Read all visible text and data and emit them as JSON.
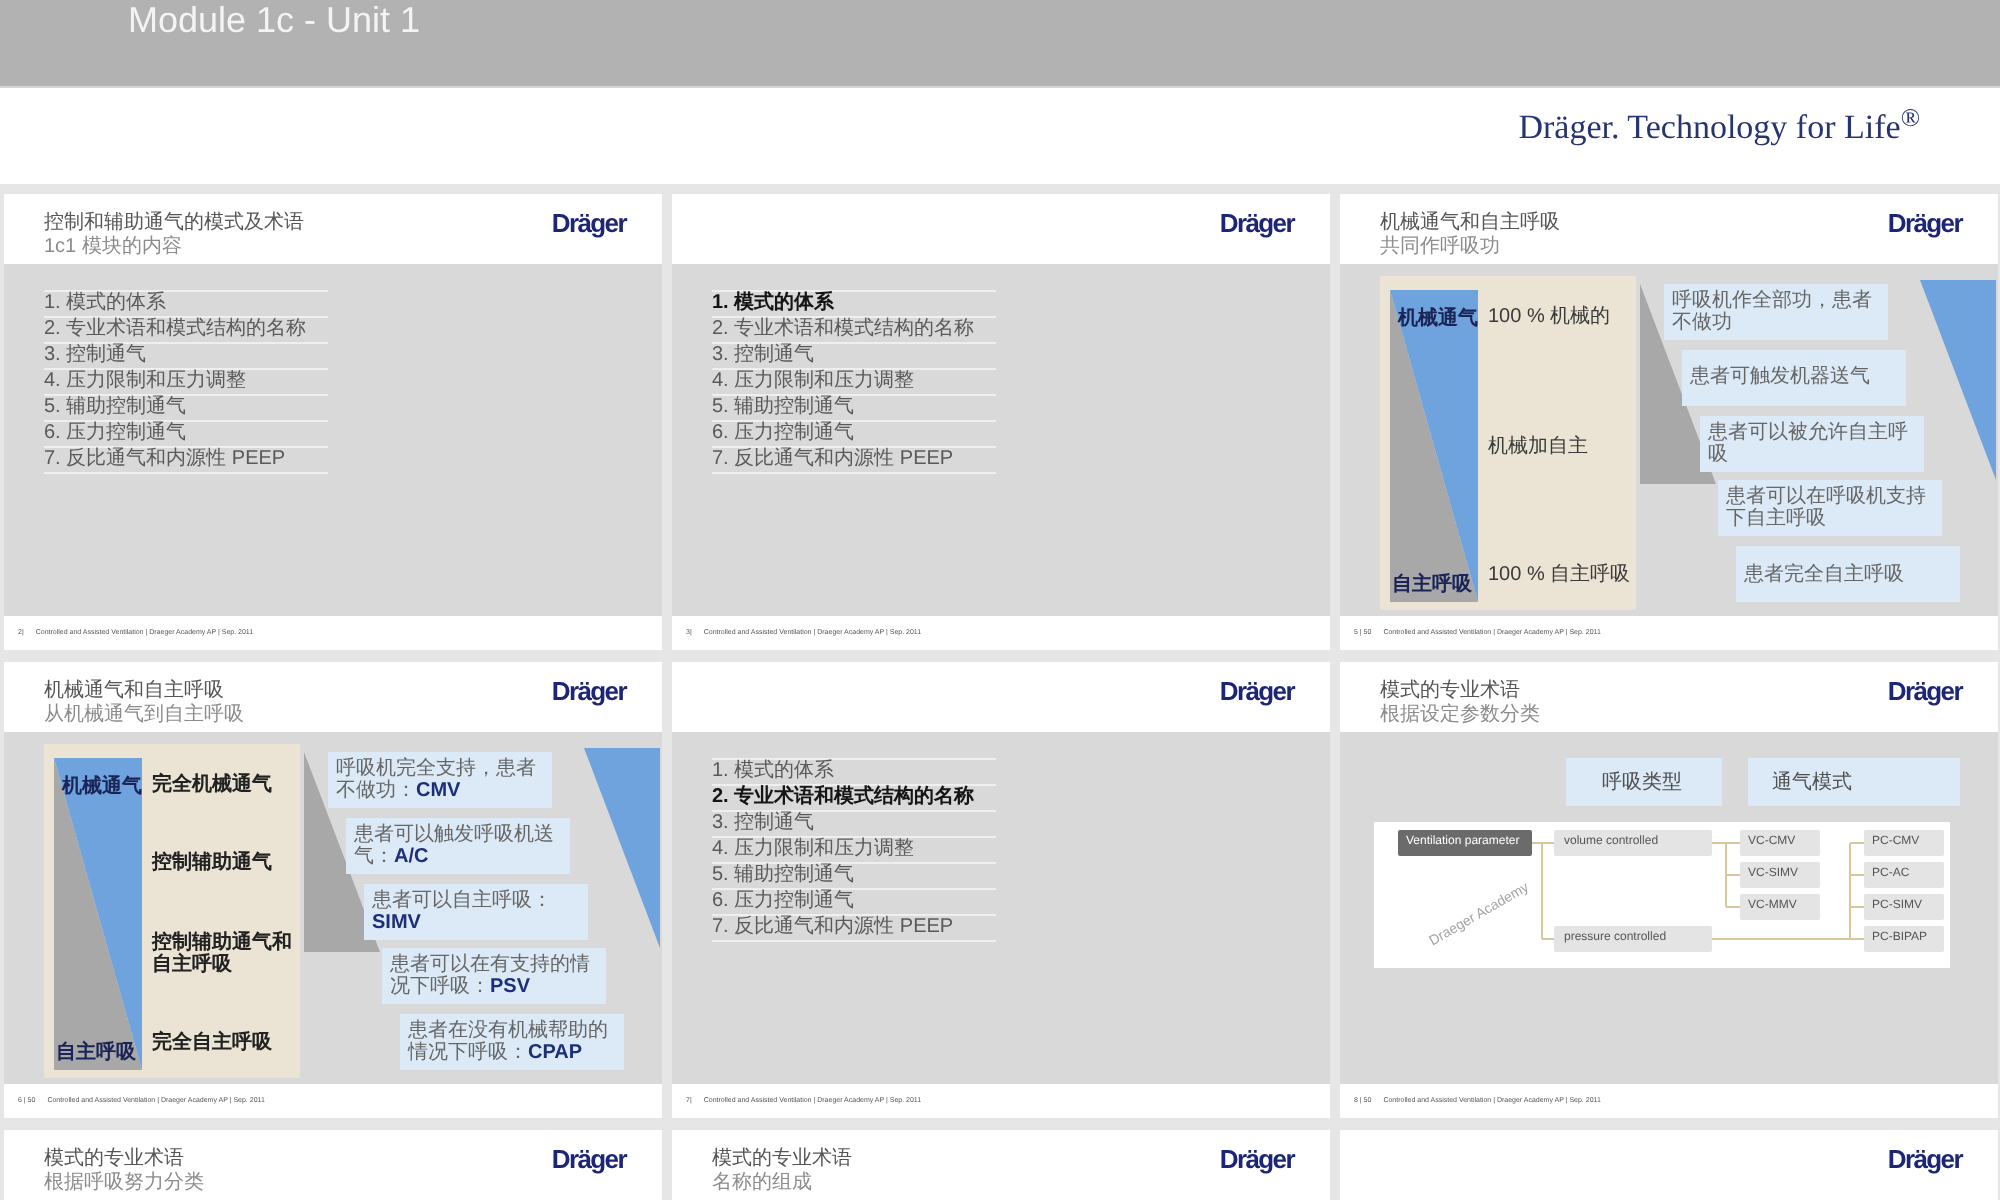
{
  "header": {
    "title": "Module 1c - Unit 1"
  },
  "brand_bar": {
    "tagline": "Dräger. Technology for Life$^{®}$"
  },
  "slides": [
    {
      "kind": "agenda",
      "title": "控制和辅助通气的模式及术语",
      "subtitle": "1c1 模块的内容",
      "logo": "Dräger",
      "items": [
        {
          "text": "1. 模式的体系",
          "selected": false
        },
        {
          "text": "2. 专业术语和模式结构的名称",
          "selected": false
        },
        {
          "text": "3. 控制通气",
          "selected": false
        },
        {
          "text": "4. 压力限制和压力调整",
          "selected": false
        },
        {
          "text": "5. 辅助控制通气",
          "selected": false
        },
        {
          "text": "6. 压力控制通气",
          "selected": false
        },
        {
          "text": "7. 反比通气和内源性 PEEP",
          "selected": false
        }
      ],
      "footer": {
        "page": "2|",
        "text": "Controlled and Assisted Ventilation | Draeger Academy AP | Sep. 2011"
      }
    },
    {
      "kind": "agenda",
      "logo": "Dräger",
      "items": [
        {
          "text": "1. 模式的体系",
          "selected": true
        },
        {
          "text": "2. 专业术语和模式结构的名称",
          "selected": false
        },
        {
          "text": "3. 控制通气",
          "selected": false
        },
        {
          "text": "4. 压力限制和压力调整",
          "selected": false
        },
        {
          "text": "5. 辅助控制通气",
          "selected": false
        },
        {
          "text": "6. 压力控制通气",
          "selected": false
        },
        {
          "text": "7. 反比通气和内源性 PEEP",
          "selected": false
        }
      ],
      "footer": {
        "page": "3|",
        "text": "Controlled and Assisted Ventilation | Draeger Academy AP | Sep. 2011"
      }
    },
    {
      "kind": "spectrum",
      "title": "机械通气和自主呼吸",
      "subtitle": "共同作呼吸功",
      "logo": "Dräger",
      "scale": {
        "top_label": "机械通气",
        "bottom_label": "自主呼吸",
        "bold": false,
        "stages": [
          "100 % 机械的",
          "机械加自主",
          "100 % 自主呼吸"
        ]
      },
      "steps": [
        "呼吸机作全部功，患者不做功",
        "患者可触发机器送气",
        "患者可以被允许自主呼吸",
        "患者可以在呼吸机支持下自主呼吸",
        "患者完全自主呼吸"
      ],
      "footer": {
        "page": "5 | 50",
        "text": "Controlled and Assisted Ventilation | Draeger Academy AP | Sep. 2011"
      }
    },
    {
      "kind": "spectrum",
      "title": "机械通气和自主呼吸",
      "subtitle": "从机械通气到自主呼吸",
      "logo": "Dräger",
      "scale": {
        "top_label": "机械通气",
        "bottom_label": "自主呼吸",
        "bold": true,
        "stages": [
          "完全机械通气",
          "控制辅助通气",
          "控制辅助通气和自主呼吸",
          "完全自主呼吸"
        ]
      },
      "steps": [
        "呼吸机完全支持，患者不做功：**CMV**",
        "患者可以触发呼吸机送气：**A/C**",
        "患者可以自主呼吸：**SIMV**",
        "患者可以在有支持的情况下呼吸：**PSV**",
        "患者在没有机械帮助的情况下呼吸：**CPAP**"
      ],
      "footer": {
        "page": "6 | 50",
        "text": "Controlled and Assisted Ventilation | Draeger Academy AP | Sep. 2011"
      }
    },
    {
      "kind": "agenda",
      "logo": "Dräger",
      "items": [
        {
          "text": "1. 模式的体系",
          "selected": false
        },
        {
          "text": "2. 专业术语和模式结构的名称",
          "selected": true
        },
        {
          "text": "3. 控制通气",
          "selected": false
        },
        {
          "text": "4. 压力限制和压力调整",
          "selected": false
        },
        {
          "text": "5. 辅助控制通气",
          "selected": false
        },
        {
          "text": "6. 压力控制通气",
          "selected": false
        },
        {
          "text": "7. 反比通气和内源性 PEEP",
          "selected": false
        }
      ],
      "footer": {
        "page": "7|",
        "text": "Controlled and Assisted Ventilation | Draeger Academy AP | Sep. 2011"
      }
    },
    {
      "kind": "classification",
      "title": "模式的专业术语",
      "subtitle": "根据设定参数分类",
      "logo": "Dräger",
      "headers": [
        "呼吸类型",
        "通气模式"
      ],
      "diagram": {
        "root": "Ventilation parameter",
        "watermark": "Draeger Academy",
        "branches": [
          {
            "label": "volume controlled",
            "modes": [
              "VC-CMV",
              "VC-SIMV",
              "VC-MMV"
            ]
          },
          {
            "label": "pressure controlled",
            "modes": [
              "PC-CMV",
              "PC-AC",
              "PC-SIMV",
              "PC-BIPAP"
            ]
          }
        ]
      },
      "footer": {
        "page": "8 | 50",
        "text": "Controlled and Assisted Ventilation | Draeger Academy AP | Sep. 2011"
      }
    },
    {
      "kind": "heading_only",
      "title": "模式的专业术语",
      "subtitle": "根据呼吸努力分类",
      "logo": "Dräger"
    },
    {
      "kind": "heading_only",
      "title": "模式的专业术语",
      "subtitle": "名称的组成",
      "logo": "Dräger"
    },
    {
      "kind": "heading_only",
      "logo": "Dräger"
    }
  ]
}
